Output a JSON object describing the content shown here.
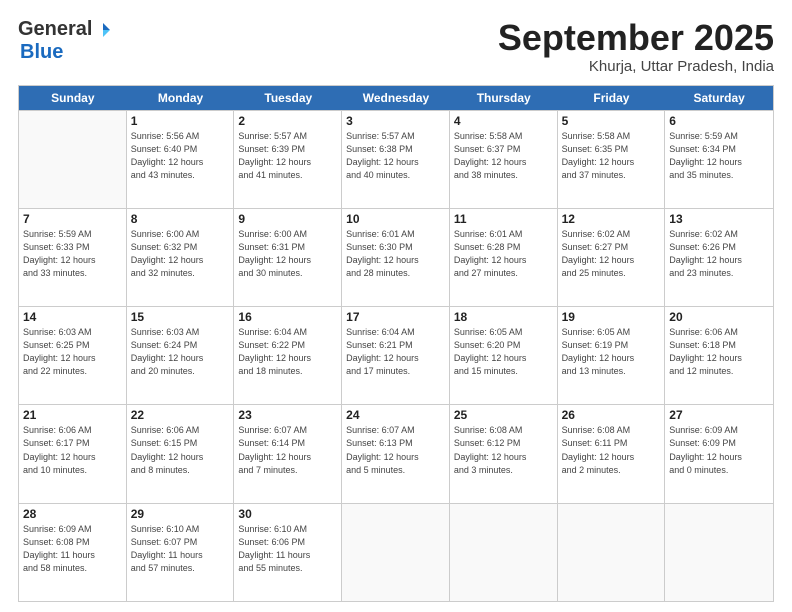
{
  "logo": {
    "general": "General",
    "blue": "Blue"
  },
  "header": {
    "month": "September 2025",
    "location": "Khurja, Uttar Pradesh, India"
  },
  "weekdays": [
    "Sunday",
    "Monday",
    "Tuesday",
    "Wednesday",
    "Thursday",
    "Friday",
    "Saturday"
  ],
  "weeks": [
    [
      {
        "day": "",
        "info": ""
      },
      {
        "day": "1",
        "info": "Sunrise: 5:56 AM\nSunset: 6:40 PM\nDaylight: 12 hours\nand 43 minutes."
      },
      {
        "day": "2",
        "info": "Sunrise: 5:57 AM\nSunset: 6:39 PM\nDaylight: 12 hours\nand 41 minutes."
      },
      {
        "day": "3",
        "info": "Sunrise: 5:57 AM\nSunset: 6:38 PM\nDaylight: 12 hours\nand 40 minutes."
      },
      {
        "day": "4",
        "info": "Sunrise: 5:58 AM\nSunset: 6:37 PM\nDaylight: 12 hours\nand 38 minutes."
      },
      {
        "day": "5",
        "info": "Sunrise: 5:58 AM\nSunset: 6:35 PM\nDaylight: 12 hours\nand 37 minutes."
      },
      {
        "day": "6",
        "info": "Sunrise: 5:59 AM\nSunset: 6:34 PM\nDaylight: 12 hours\nand 35 minutes."
      }
    ],
    [
      {
        "day": "7",
        "info": "Sunrise: 5:59 AM\nSunset: 6:33 PM\nDaylight: 12 hours\nand 33 minutes."
      },
      {
        "day": "8",
        "info": "Sunrise: 6:00 AM\nSunset: 6:32 PM\nDaylight: 12 hours\nand 32 minutes."
      },
      {
        "day": "9",
        "info": "Sunrise: 6:00 AM\nSunset: 6:31 PM\nDaylight: 12 hours\nand 30 minutes."
      },
      {
        "day": "10",
        "info": "Sunrise: 6:01 AM\nSunset: 6:30 PM\nDaylight: 12 hours\nand 28 minutes."
      },
      {
        "day": "11",
        "info": "Sunrise: 6:01 AM\nSunset: 6:28 PM\nDaylight: 12 hours\nand 27 minutes."
      },
      {
        "day": "12",
        "info": "Sunrise: 6:02 AM\nSunset: 6:27 PM\nDaylight: 12 hours\nand 25 minutes."
      },
      {
        "day": "13",
        "info": "Sunrise: 6:02 AM\nSunset: 6:26 PM\nDaylight: 12 hours\nand 23 minutes."
      }
    ],
    [
      {
        "day": "14",
        "info": "Sunrise: 6:03 AM\nSunset: 6:25 PM\nDaylight: 12 hours\nand 22 minutes."
      },
      {
        "day": "15",
        "info": "Sunrise: 6:03 AM\nSunset: 6:24 PM\nDaylight: 12 hours\nand 20 minutes."
      },
      {
        "day": "16",
        "info": "Sunrise: 6:04 AM\nSunset: 6:22 PM\nDaylight: 12 hours\nand 18 minutes."
      },
      {
        "day": "17",
        "info": "Sunrise: 6:04 AM\nSunset: 6:21 PM\nDaylight: 12 hours\nand 17 minutes."
      },
      {
        "day": "18",
        "info": "Sunrise: 6:05 AM\nSunset: 6:20 PM\nDaylight: 12 hours\nand 15 minutes."
      },
      {
        "day": "19",
        "info": "Sunrise: 6:05 AM\nSunset: 6:19 PM\nDaylight: 12 hours\nand 13 minutes."
      },
      {
        "day": "20",
        "info": "Sunrise: 6:06 AM\nSunset: 6:18 PM\nDaylight: 12 hours\nand 12 minutes."
      }
    ],
    [
      {
        "day": "21",
        "info": "Sunrise: 6:06 AM\nSunset: 6:17 PM\nDaylight: 12 hours\nand 10 minutes."
      },
      {
        "day": "22",
        "info": "Sunrise: 6:06 AM\nSunset: 6:15 PM\nDaylight: 12 hours\nand 8 minutes."
      },
      {
        "day": "23",
        "info": "Sunrise: 6:07 AM\nSunset: 6:14 PM\nDaylight: 12 hours\nand 7 minutes."
      },
      {
        "day": "24",
        "info": "Sunrise: 6:07 AM\nSunset: 6:13 PM\nDaylight: 12 hours\nand 5 minutes."
      },
      {
        "day": "25",
        "info": "Sunrise: 6:08 AM\nSunset: 6:12 PM\nDaylight: 12 hours\nand 3 minutes."
      },
      {
        "day": "26",
        "info": "Sunrise: 6:08 AM\nSunset: 6:11 PM\nDaylight: 12 hours\nand 2 minutes."
      },
      {
        "day": "27",
        "info": "Sunrise: 6:09 AM\nSunset: 6:09 PM\nDaylight: 12 hours\nand 0 minutes."
      }
    ],
    [
      {
        "day": "28",
        "info": "Sunrise: 6:09 AM\nSunset: 6:08 PM\nDaylight: 11 hours\nand 58 minutes."
      },
      {
        "day": "29",
        "info": "Sunrise: 6:10 AM\nSunset: 6:07 PM\nDaylight: 11 hours\nand 57 minutes."
      },
      {
        "day": "30",
        "info": "Sunrise: 6:10 AM\nSunset: 6:06 PM\nDaylight: 11 hours\nand 55 minutes."
      },
      {
        "day": "",
        "info": ""
      },
      {
        "day": "",
        "info": ""
      },
      {
        "day": "",
        "info": ""
      },
      {
        "day": "",
        "info": ""
      }
    ]
  ]
}
